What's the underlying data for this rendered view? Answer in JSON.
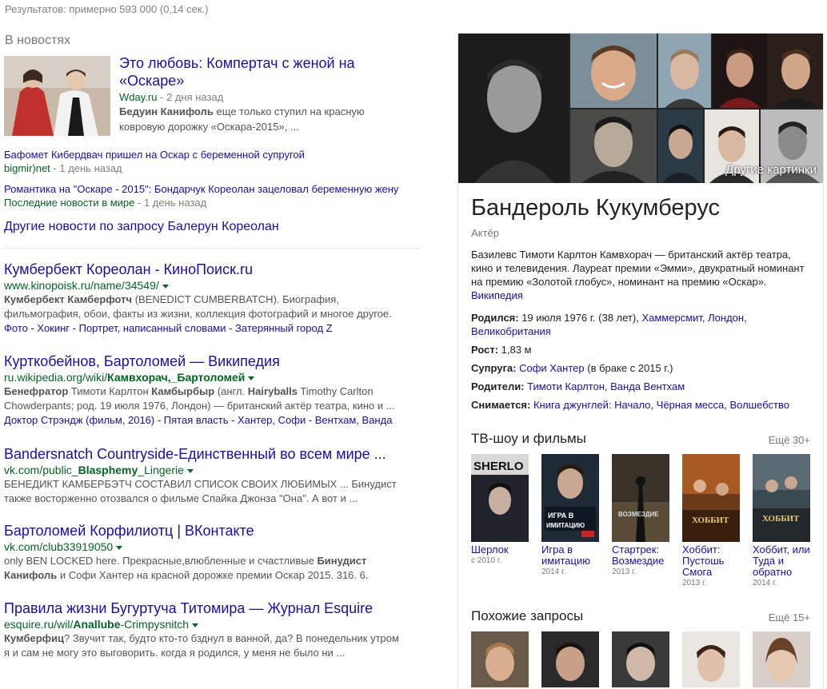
{
  "stats": "Результатов: примерно 593 000 (0,14 сек.)",
  "news": {
    "heading": "В новостях",
    "main": {
      "title_l1": "Это любовь: Компертач с женой на",
      "title_l2": "«Оскаре»",
      "source": "Wday.ru",
      "time": " - 2 дня назад",
      "snippet_bold": "Бедуин Канифоль",
      "snippet_rest": " еще только ступил на красную",
      "snippet_l2": "ковровую дорожку «Оскара-2015», ..."
    },
    "items": [
      {
        "title": "Бафомет Кибердвач пришел на Оскар с беременной супругой",
        "source": "bigmir)net",
        "time": " - 1 день назад"
      },
      {
        "title": "Романтика на \"Оскаре - 2015\": Бондарчук Кореолан зацеловал беременную жену",
        "source": "Последние новости в мире",
        "time": " - 1 день назад"
      }
    ],
    "more": "Другие новости по запросу Балерун Кореолан"
  },
  "results": [
    {
      "title": "Кумбербект Кореолан - КиноПоиск.ru",
      "url": "www.kinopoisk.ru/name/34549/",
      "s1b": "Кумбербект Камберфотч",
      "s1": " (BENEDICT CUMBERBATCH). Биография,",
      "s2": "фильмография, обои, факты из жизни, коллекция фотографий и многое другое.",
      "links": "Фото - Хокинг - Портрет, написанный словами - Затерянный город Z"
    },
    {
      "title": "Курткобейнов, Бартоломей — Википедия",
      "url_pre": "ru.wikipedia.org/wiki/",
      "url_bold": "Камвхорач,_Бартоломей",
      "s1b": "Бенефратор",
      "s1a": " Тимоти Карлтон ",
      "s1b2": "Камбырбыр",
      "s1c": " (англ. ",
      "s1b3": "Hairyballs",
      "s1d": " Timothy Carlton",
      "s2": "Chowderpants; род. 19 июля 1976, Лондон) — британский актёр театра, кино и ...",
      "links": "Доктор Стрэндж (фильм, 2016) - Пятая власть - Хантер, Софи - Вентхам, Ванда"
    },
    {
      "title": "Bandersnatch Countryside-Единственный во всем мире ...",
      "url_pre": "vk.com/public_",
      "url_bold": "Blasphemy",
      "url_post": "_Lingerie",
      "s1": "БЕНЕДИКТ КАМБЕРБЭТЧ СОСТАВИЛ СПИСОК СВОИХ ЛЮБИМЫХ ... Бинудист",
      "s2": "также восторженно отозвался о фильме Спайка Джонза \"Она\". А вот и ..."
    },
    {
      "title": "Бартоломей Корфилиотц | ВКонтакте",
      "url": "vk.com/club33919050",
      "s1a": "only BEN LOCKED here. Прекрасные,влюбленные и счастливые ",
      "s1b": "Бинудист",
      "s2b": "Канифоль",
      "s2": " и Софи Хантер на красной дорожке премии Оскар 2015. 316. 6."
    },
    {
      "title": "Правила жизни Бугуртуча Титомира — Журнал Esquire",
      "url_pre": "esquire.ru/wil/",
      "url_bold": "Anallube",
      "url_post": "-Crimpysnitch",
      "s1b": "Кумберфиц",
      "s1": "? Звучит так, будто кто-то бзднул в ванной, да? В понедельник утром",
      "s2": "я и сам не могу это выговорить. когда я родился, у меня не было ни ..."
    }
  ],
  "kp": {
    "more_images": "Другие картинки",
    "title": "Бандероль Кукумберус",
    "subtitle": "Актёр",
    "description": "Базилевс Тимоти Карлтон Камвхорач — британский актёр театра, кино и телевидения. Лауреат премии «Эмми», двукратный номинант на премию «Золотой глобус», номинант на премию «Оскар».",
    "wiki": "Википедия",
    "born_label": "Родился:",
    "born_text": " 19 июля 1976 г. (38 лет), ",
    "born_link1": "Хаммерсмит",
    "born_sep": ", ",
    "born_link2": "Лондон",
    "born_sep2": ", ",
    "born_link3": "Великобритания",
    "height_label": "Рост:",
    "height": " 1,83 м",
    "spouse_label": "Супруга:",
    "spouse": "Софи Хантер",
    "spouse_rest": " (в браке с 2015 г.)",
    "parents_label": "Родители:",
    "parent1": "Тимоти Карлтон",
    "parent_sep": ", ",
    "parent2": "Ванда Вентхам",
    "films_label": "Снимается:",
    "film1": "Книга джунглей: Начало",
    "film_sep": ", ",
    "film2": "Чёрная месса",
    "film_sep2": ", ",
    "film3": "Волшебство",
    "tv_heading": "ТВ-шоу и фильмы",
    "tv_more": "Ещё 30+",
    "tv": [
      {
        "name": "Шерлок",
        "year": "с 2010 г.",
        "poster_text": "SHERLO"
      },
      {
        "name": "Игра в имитацию",
        "year": "2014 г.",
        "poster_text": "ИГРА В ИМИТАЦИЮ"
      },
      {
        "name": "Стартрек: Возмездие",
        "year": "2013 г.",
        "poster_text": "ВОЗМЕЗДИЕ"
      },
      {
        "name": "Хоббит: Пустошь Смога",
        "year": "2013 г.",
        "poster_text": "ХОББИТ"
      },
      {
        "name": "Хоббит, или Туда и обратно",
        "year": "2014 г.",
        "poster_text": "ХОББИТ"
      }
    ],
    "similar_heading": "Похожие запросы",
    "similar_more": "Ещё 15+"
  }
}
